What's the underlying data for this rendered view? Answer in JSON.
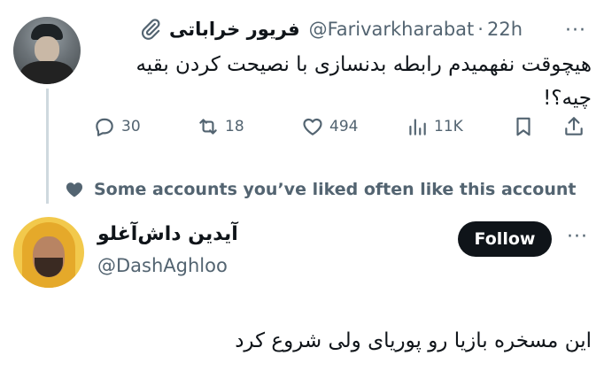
{
  "tweet": {
    "author_name": "فریور خراباتی",
    "handle": "@Farivarkharabat",
    "separator": "·",
    "time": "22h",
    "more": "···",
    "text": "هیچوقت نفهمیدم رابطه بدنسازی با نصیحت کردن بقیه چیه؟!",
    "stats": {
      "replies": "30",
      "reposts": "18",
      "likes": "494",
      "views": "11K"
    }
  },
  "social_context": "Some accounts you’ve liked often like this account",
  "suggested": {
    "name": "آیدین داش‌آغلو",
    "handle": "@DashAghloo",
    "follow_label": "Follow",
    "more": "···",
    "text": "این مسخره بازیا رو پوریای ولی شروع کرد"
  },
  "colors": {
    "text": "#0f1419",
    "muted": "#536471",
    "button_bg": "#0f1419",
    "button_text": "#ffffff",
    "thread_line": "#cfd9de"
  }
}
